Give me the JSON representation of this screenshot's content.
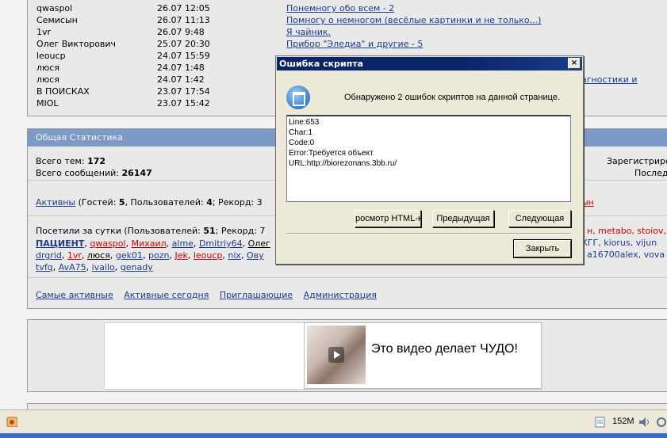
{
  "recent": [
    {
      "user": "qwaspol",
      "date": "26.07 12:05",
      "topic": "Понемногу обо всем - 2"
    },
    {
      "user": "Семисын",
      "date": "26.07 11:13",
      "topic": "Помногу о немногом (весёлые картинки и не только...)"
    },
    {
      "user": "1vr",
      "date": "26.07 9:48",
      "topic": "Я чайник."
    },
    {
      "user": "Олег Викторович",
      "date": "25.07 20:30",
      "topic": "Прибор \"Эледиа\" и другие - 5"
    },
    {
      "user": "leoucp",
      "date": "24.07 15:59",
      "topic": ""
    },
    {
      "user": "люся",
      "date": "24.07 1:48",
      "topic": ""
    },
    {
      "user": "люся",
      "date": "24.07 1:42",
      "topic": "агностики и"
    },
    {
      "user": "В ПОИСКАХ",
      "date": "23.07 17:54",
      "topic": ""
    },
    {
      "user": "MIOL",
      "date": "23.07 15:42",
      "topic": ""
    }
  ],
  "stats": {
    "header": "Общая Статистика",
    "topics_label": "Всего тем:",
    "topics_value": "172",
    "messages_label": "Всего сообщений:",
    "messages_value": "26147",
    "registered_label": "Зарегистриро",
    "last_label": "Послед",
    "active_link": "Активны",
    "active_text": "(Гостей: ",
    "guests": "5",
    "users_text": ", Пользователей: ",
    "users": "4",
    "record_text": "; Рекорд: 3",
    "right_red": "ын",
    "visited_prefix": "Посетили за сутки (Пользователей: ",
    "visited_users": "51",
    "visited_record": "; Рекорд: 7",
    "row2_right": "н, metabo, stoiov,",
    "row3_right": "КГГ, kiorus, vijun",
    "row4_right": "a16700alex, vova",
    "footer_links": [
      "Самые активные",
      "Активные сегодня",
      "Приглашающие",
      "Администрация"
    ]
  },
  "userlist": {
    "row1": [
      {
        "t": "ПАЦИЕНТ",
        "c": "blue-bold"
      },
      {
        "t": ", ",
        "c": "plain"
      },
      {
        "t": "qwaspol",
        "c": "red"
      },
      {
        "t": ", ",
        "c": "plain"
      },
      {
        "t": "Михаил",
        "c": "red"
      },
      {
        "t": ", ",
        "c": "plain"
      },
      {
        "t": "alme",
        "c": "blue"
      },
      {
        "t": ", ",
        "c": "plain"
      },
      {
        "t": "Dmitriy64",
        "c": "blue"
      },
      {
        "t": ", ",
        "c": "plain"
      },
      {
        "t": "Олег",
        "c": "dark"
      }
    ],
    "row2": [
      {
        "t": "drgrid",
        "c": "blue"
      },
      {
        "t": ", ",
        "c": "plain"
      },
      {
        "t": "1vr",
        "c": "red"
      },
      {
        "t": ", ",
        "c": "plain"
      },
      {
        "t": "люся",
        "c": "dark"
      },
      {
        "t": ", ",
        "c": "plain"
      },
      {
        "t": "gek01",
        "c": "blue"
      },
      {
        "t": ", ",
        "c": "plain"
      },
      {
        "t": "pozn",
        "c": "blue"
      },
      {
        "t": ", ",
        "c": "plain"
      },
      {
        "t": "Jek",
        "c": "red"
      },
      {
        "t": ", ",
        "c": "plain"
      },
      {
        "t": "leoucp",
        "c": "red"
      },
      {
        "t": ", ",
        "c": "plain"
      },
      {
        "t": "nix",
        "c": "blue"
      },
      {
        "t": ", ",
        "c": "plain"
      },
      {
        "t": "Ову",
        "c": "blue"
      }
    ],
    "row3": [
      {
        "t": "tvfq",
        "c": "blue"
      },
      {
        "t": ", ",
        "c": "plain"
      },
      {
        "t": "AvA75",
        "c": "blue"
      },
      {
        "t": ", ",
        "c": "plain"
      },
      {
        "t": "ivailo",
        "c": "blue"
      },
      {
        "t": ", ",
        "c": "plain"
      },
      {
        "t": "genady",
        "c": "blue"
      }
    ]
  },
  "ad": {
    "text": "Это видео делает ЧУДО!"
  },
  "dialog": {
    "title": "Ошибка скрипта",
    "close": "×",
    "message": "Обнаружено 2 ошибок скриптов на данной странице.",
    "details": [
      "Line:653",
      "Char:1",
      "Code:0",
      "Error:Требуется объект",
      "URL:http://biorezonans.3bb.ru/"
    ],
    "btn_view": "росмотр HTML-к",
    "btn_prev": "Предыдущая",
    "btn_next": "Следующая",
    "btn_close": "Закрыть"
  },
  "statusbar": {
    "memory": "152M"
  },
  "colors": {
    "link": "#1a3c8c",
    "red": "#cc0000",
    "header": "#7d9ac4",
    "dialog_title": "#0a246a"
  }
}
